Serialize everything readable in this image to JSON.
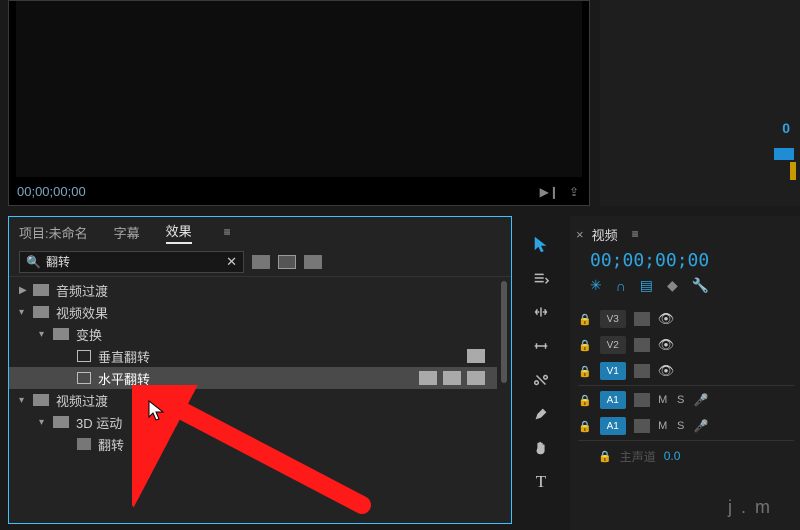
{
  "preview": {
    "timecode": "00;00;00;00",
    "controls": {
      "play_icon": "▶❙",
      "export_icon": "⇪"
    }
  },
  "right_top": {
    "value": "0"
  },
  "effects_panel": {
    "tabs": {
      "project": "项目:未命名",
      "captions": "字幕",
      "effects": "效果"
    },
    "search": {
      "placeholder": "",
      "value": "翻转",
      "preset_icons": [
        "preset",
        "fx32",
        "yuv"
      ]
    },
    "tree": [
      {
        "indent": 0,
        "arrow": "▶",
        "type": "folder",
        "label": "音频过渡"
      },
      {
        "indent": 0,
        "arrow": "▾",
        "type": "folder",
        "label": "视频效果"
      },
      {
        "indent": 1,
        "arrow": "▾",
        "type": "folder",
        "label": "变换"
      },
      {
        "indent": 2,
        "arrow": "",
        "type": "preset",
        "label": "垂直翻转",
        "badges": 1
      },
      {
        "indent": 2,
        "arrow": "",
        "type": "preset",
        "label": "水平翻转",
        "badges": 3,
        "selected": true
      },
      {
        "indent": 0,
        "arrow": "▾",
        "type": "folder",
        "label": "视频过渡"
      },
      {
        "indent": 1,
        "arrow": "▾",
        "type": "folder",
        "label": "3D 运动"
      },
      {
        "indent": 2,
        "arrow": "",
        "type": "preset-dark",
        "label": "翻转"
      }
    ]
  },
  "tools": [
    "selection",
    "track-select",
    "ripple",
    "rolling",
    "slip",
    "pen",
    "hand",
    "type"
  ],
  "timeline": {
    "title": "视频",
    "timecode": "00;00;00;00",
    "snap_icons": [
      "snap",
      "magnet",
      "linked",
      "markers",
      "wrench"
    ],
    "tracks": [
      {
        "kind": "V",
        "name": "V3",
        "on": false,
        "eye": true
      },
      {
        "kind": "V",
        "name": "V2",
        "on": false,
        "eye": true
      },
      {
        "kind": "V",
        "name": "V1",
        "on": true,
        "eye": true
      },
      {
        "kind": "A",
        "name": "A1",
        "on": true,
        "m": "M",
        "s": "S",
        "mic": true
      },
      {
        "kind": "A",
        "name": "A1",
        "on": true,
        "m": "M",
        "s": "S",
        "mic": true
      }
    ],
    "footer": {
      "label": "主声道",
      "value": "0.0"
    }
  },
  "watermark": "j . m"
}
